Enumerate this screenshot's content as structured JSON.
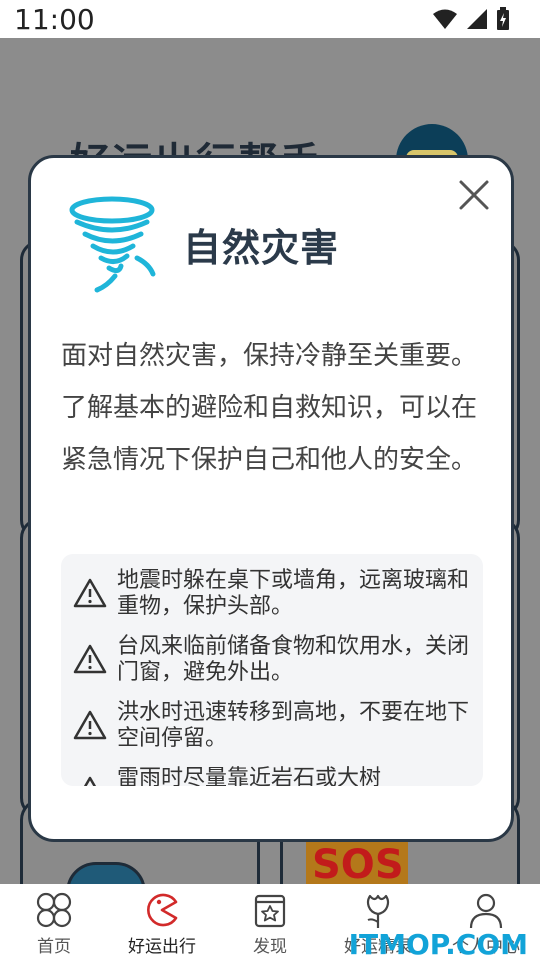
{
  "status_bar": {
    "time": "11:00"
  },
  "background": {
    "title": "好运出行帮手",
    "badge": "SOS"
  },
  "modal": {
    "title": "自然灾害",
    "description": "面对自然灾害，保持冷静至关重要。了解基本的避险和自救知识，可以在紧急情况下保护自己和他人的安全。",
    "tips": [
      "地震时躲在桌下或墙角，远离玻璃和重物，保护头部。",
      "台风来临前储备食物和饮用水，关闭门窗，避免外出。",
      "洪水时迅速转移到高地，不要在地下空间停留。",
      "雷雨时尽量靠近岩石或大树"
    ]
  },
  "bottom_nav": {
    "items": [
      {
        "label": "首页",
        "icon": "grid-icon"
      },
      {
        "label": "好运出行",
        "icon": "pacman-icon"
      },
      {
        "label": "发现",
        "icon": "star-card-icon"
      },
      {
        "label": "好运精录",
        "icon": "flower-icon"
      },
      {
        "label": "个人中心",
        "icon": "user-icon"
      }
    ],
    "active_index": 1,
    "active_color": "#d22a2a"
  },
  "watermark": "ITMOP.COM"
}
